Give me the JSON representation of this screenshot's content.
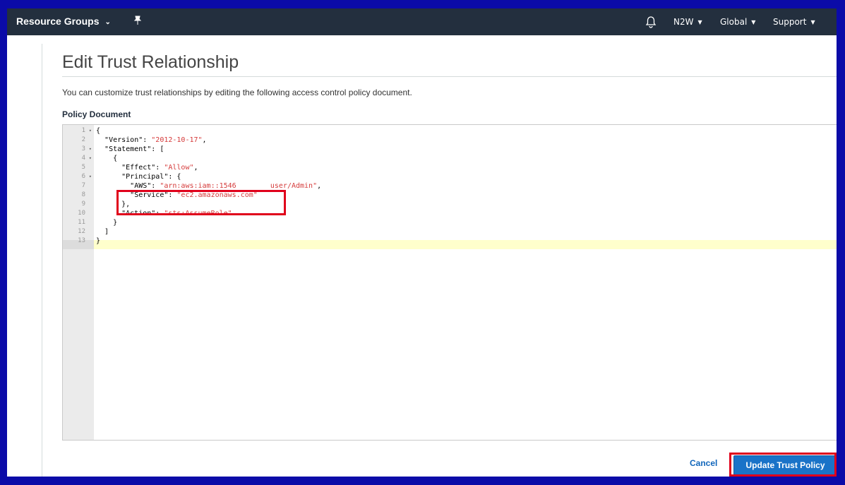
{
  "nav": {
    "brand": "Resource Groups",
    "account": "N2W",
    "region": "Global",
    "support": "Support"
  },
  "page": {
    "title": "Edit Trust Relationship",
    "description": "You can customize trust relationships by editing the following access control policy document.",
    "section_label": "Policy Document"
  },
  "editor": {
    "gutter": [
      {
        "n": "1",
        "fold": "▾"
      },
      {
        "n": "2",
        "fold": ""
      },
      {
        "n": "3",
        "fold": "▾"
      },
      {
        "n": "4",
        "fold": "▾"
      },
      {
        "n": "5",
        "fold": ""
      },
      {
        "n": "6",
        "fold": "▾"
      },
      {
        "n": "7",
        "fold": ""
      },
      {
        "n": "8",
        "fold": ""
      },
      {
        "n": "9",
        "fold": ""
      },
      {
        "n": "10",
        "fold": ""
      },
      {
        "n": "11",
        "fold": ""
      },
      {
        "n": "12",
        "fold": ""
      },
      {
        "n": "13",
        "fold": ""
      }
    ],
    "lines": [
      {
        "indent": "",
        "key": "",
        "value": "",
        "tail": "{"
      },
      {
        "indent": "  ",
        "key": "\"Version\": ",
        "value": "\"2012-10-17\"",
        "tail": ","
      },
      {
        "indent": "  ",
        "key": "\"Statement\": ",
        "value": "",
        "tail": "["
      },
      {
        "indent": "    ",
        "key": "",
        "value": "",
        "tail": "{"
      },
      {
        "indent": "      ",
        "key": "\"Effect\": ",
        "value": "\"Allow\"",
        "tail": ","
      },
      {
        "indent": "      ",
        "key": "\"Principal\": ",
        "value": "",
        "tail": "{"
      },
      {
        "indent": "        ",
        "key": "\"AWS\": ",
        "value": "\"arn:aws:iam::1546        user/Admin\"",
        "tail": ","
      },
      {
        "indent": "        ",
        "key": "\"Service\": ",
        "value": "\"ec2.amazonaws.com\"",
        "tail": ""
      },
      {
        "indent": "      ",
        "key": "",
        "value": "",
        "tail": "},"
      },
      {
        "indent": "      ",
        "key": "\"Action\": ",
        "value": "\"sts:AssumeRole\"",
        "tail": ""
      },
      {
        "indent": "    ",
        "key": "",
        "value": "",
        "tail": "}"
      },
      {
        "indent": "  ",
        "key": "",
        "value": "",
        "tail": "]"
      },
      {
        "indent": "",
        "key": "",
        "value": "",
        "tail": "}"
      }
    ]
  },
  "actions": {
    "cancel": "Cancel",
    "update": "Update Trust Policy"
  },
  "colors": {
    "navbar": "#232f3e",
    "primary_button": "#1a73c8",
    "highlight": "#e0001b",
    "string": "#d53a3a",
    "outer_border": "#0b0ba8"
  }
}
